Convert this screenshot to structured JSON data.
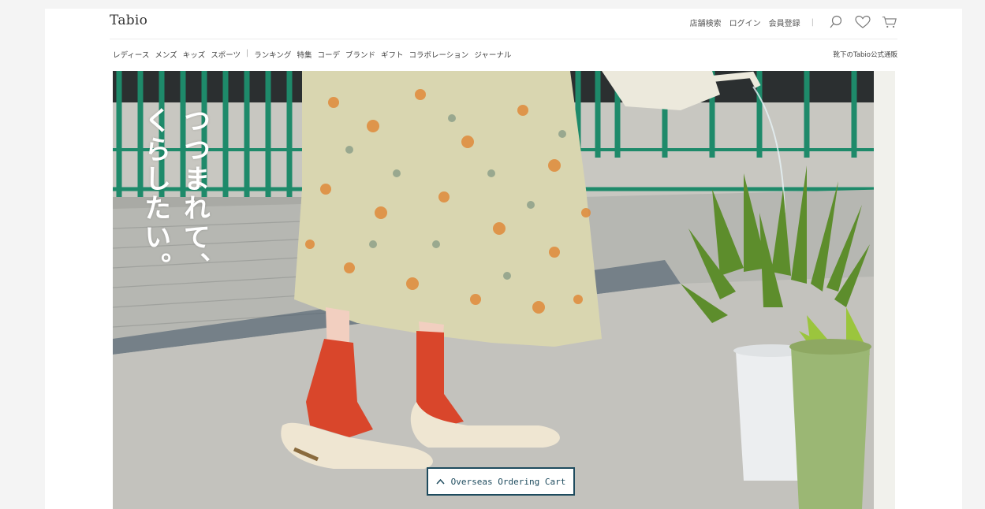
{
  "brand": {
    "logo_text": "Tabio"
  },
  "util_nav": {
    "store_search": "店舗検索",
    "login": "ログイン",
    "register": "会員登録",
    "divider": "|",
    "icons": [
      "search-icon",
      "heart-icon",
      "cart-icon"
    ]
  },
  "category_nav": {
    "items": [
      "レディース",
      "メンズ",
      "キッズ",
      "スポーツ",
      "|",
      "ランキング",
      "特集",
      "コーデ",
      "ブランド",
      "ギフト",
      "コラボレーション",
      "ジャーナル"
    ],
    "sub_link": "靴下のTabio公式通販"
  },
  "hero": {
    "copy_col1": "つつまれて、",
    "copy_col2": "くらしたい。",
    "colors": {
      "railing": "#1e8a6a",
      "socks": "#d9462b",
      "shoes": "#efe6d2",
      "pot_white": "#eceef0",
      "pot_green": "#9bb774"
    }
  },
  "cart_button": {
    "icon": "chevron-up-icon",
    "label": "Overseas Ordering Cart"
  }
}
